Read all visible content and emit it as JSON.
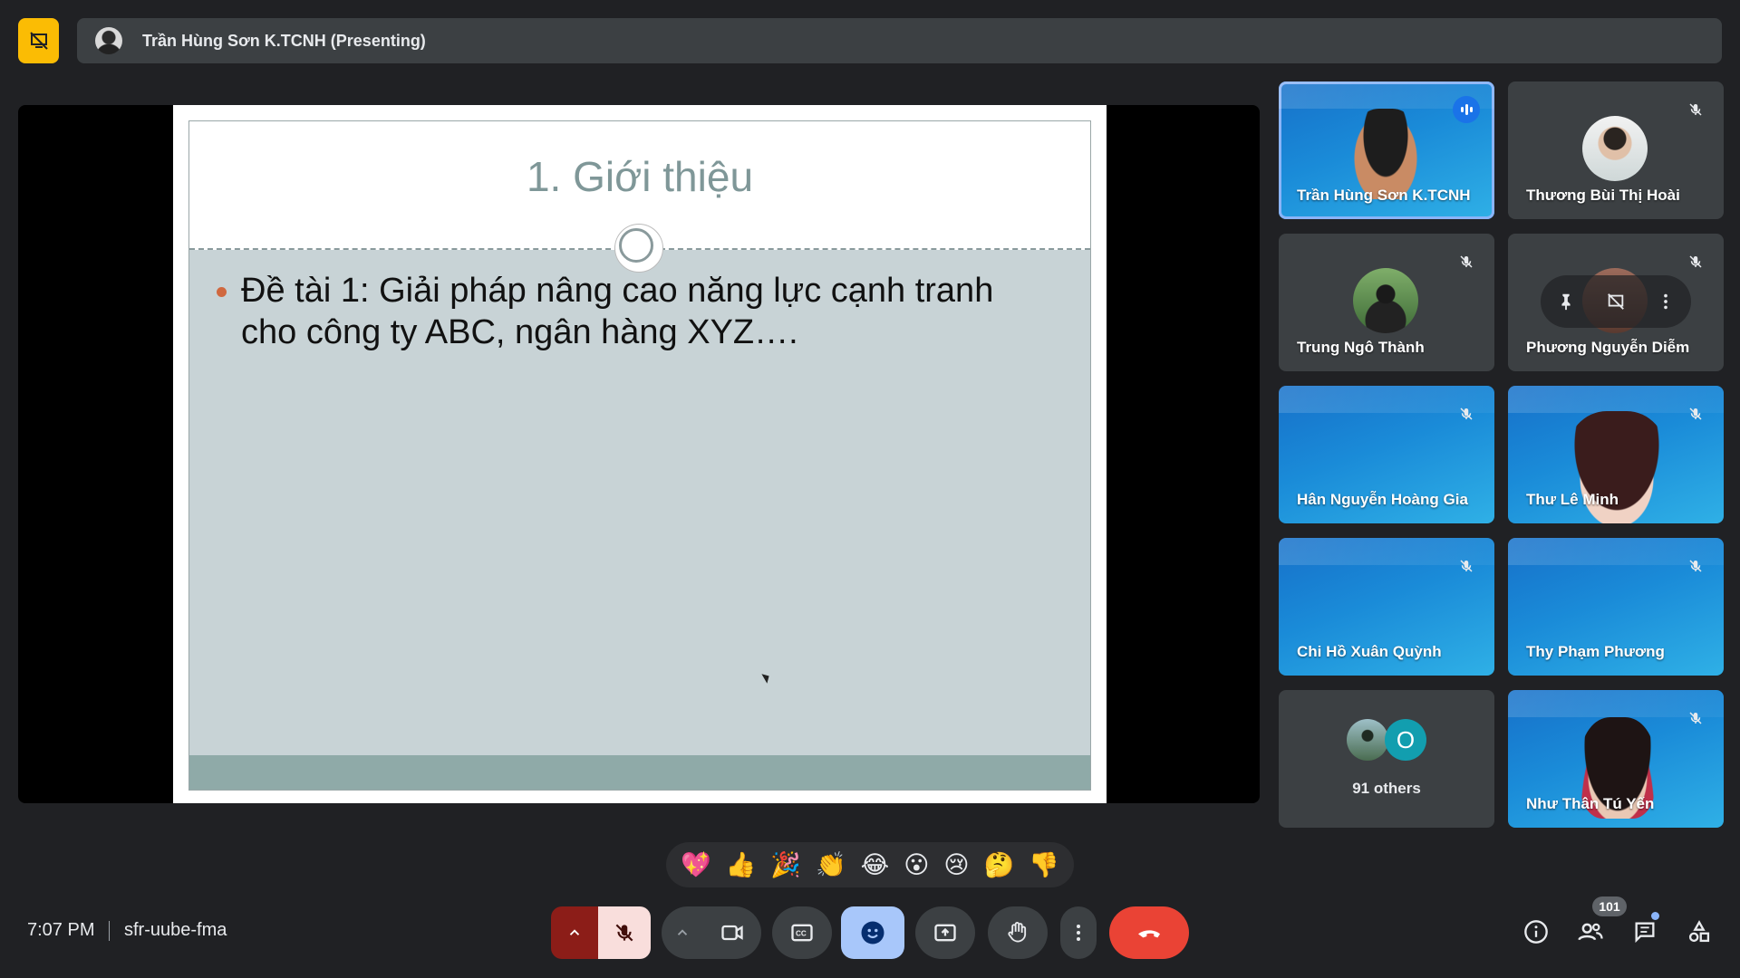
{
  "presenter_bar": {
    "name": "Trần Hùng Sơn K.TCNH (Presenting)"
  },
  "slide": {
    "title": "1. Giới thiệu",
    "bullet": "Đề tài 1: Giải pháp nâng cao năng lực cạnh tranh cho công ty ABC, ngân hàng XYZ…."
  },
  "participants": [
    {
      "name": "Trần Hùng Sơn K.TCNH",
      "speaking": true
    },
    {
      "name": "Thương Bùi Thị Hoài",
      "muted": true
    },
    {
      "name": "Trung Ngô Thành",
      "muted": true
    },
    {
      "name": "Phương Nguyễn Diễm",
      "muted": true
    },
    {
      "name": "Hân Nguyễn Hoàng Gia",
      "muted": true
    },
    {
      "name": "Thư Lê Minh",
      "muted": true
    },
    {
      "name": "Chi Hồ Xuân Quỳnh",
      "muted": true
    },
    {
      "name": "Thy Phạm Phương",
      "muted": true
    },
    {
      "name": "Như Thân Tú Yến",
      "muted": true
    }
  ],
  "others": {
    "avatar_letter": "O",
    "label": "91 others"
  },
  "reactions": [
    "💖",
    "👍",
    "🎉",
    "👏",
    "😂",
    "😮",
    "😢",
    "🤔",
    "👎"
  ],
  "bottom_bar": {
    "time": "7:07 PM",
    "meeting_code": "sfr-uube-fma",
    "participant_count": "101"
  },
  "colors": {
    "accent": "#8ab4f8",
    "end_call": "#ea4335",
    "stop_presenting": "#fbbc04",
    "mic_off_bg": "#f9dedc"
  },
  "icons": {
    "stop_presenting": "stop-presenting-icon",
    "mic_off": "mic-off-icon",
    "camera": "camera-icon",
    "captions": "captions-icon",
    "emoji": "emoji-icon",
    "present": "present-screen-icon",
    "raise_hand": "raise-hand-icon",
    "more": "more-options-icon",
    "end_call": "end-call-icon",
    "info": "info-icon",
    "people": "people-icon",
    "chat": "chat-icon",
    "activities": "activities-icon"
  }
}
